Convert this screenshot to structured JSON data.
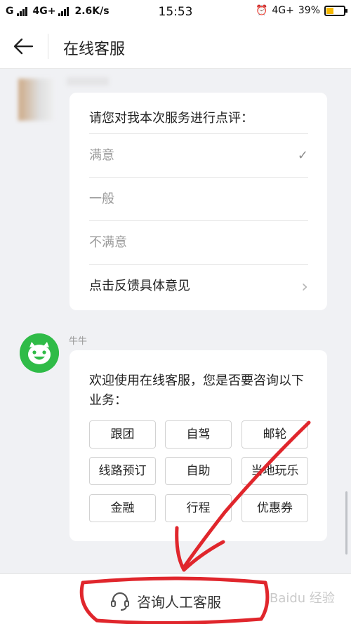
{
  "status_bar": {
    "network_left": "G",
    "network_mid": "4G+",
    "speed": "2.6K/s",
    "time": "15:53",
    "network_right": "4G+",
    "battery": "39%"
  },
  "header": {
    "title": "在线客服"
  },
  "rating": {
    "prompt": "请您对我本次服务进行点评：",
    "options": [
      "满意",
      "一般",
      "不满意"
    ],
    "selected_mark": "✓",
    "feedback_label": "点击反馈具体意见",
    "feedback_chevron": "›"
  },
  "bot": {
    "name": "牛牛",
    "message": "欢迎使用在线客服，您是否要咨询以下业务：",
    "services": [
      "跟团",
      "自驾",
      "邮轮",
      "线路预订",
      "自助",
      "当地玩乐",
      "金融",
      "行程",
      "优惠券"
    ]
  },
  "bottom": {
    "human_service_label": "咨询人工客服"
  },
  "watermark": "Baidu 经验",
  "colors": {
    "bot_green": "#2fbb47",
    "annotation_red": "#e0262c"
  }
}
